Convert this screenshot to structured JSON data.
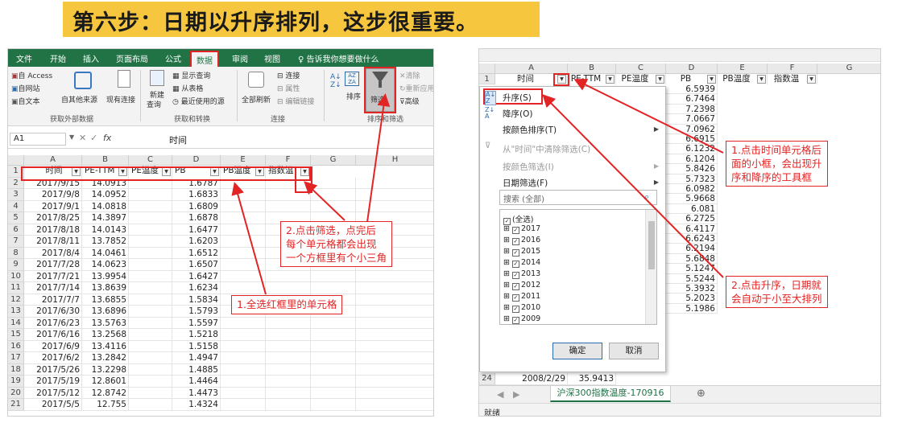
{
  "title": "第六步：日期以升序排列，这步很重要。",
  "left": {
    "menu": [
      "文件",
      "开始",
      "插入",
      "页面布局",
      "公式",
      "数据",
      "审阅",
      "视图"
    ],
    "tell_me": "告诉我你想要做什么",
    "ribbon": {
      "access": "自 Access",
      "web": "自网站",
      "text": "自文本",
      "other_sources": "自其他来源",
      "existing": "现有连接",
      "new_query": "新建",
      "new_query2": "查询",
      "show_query": "显示查询",
      "from_table": "从表格",
      "recent_sources": "最近使用的源",
      "refresh_all": "全部刷新",
      "connections": "连接",
      "properties": "属性",
      "edit_links": "编辑链接",
      "sort": "排序",
      "filter": "筛选",
      "clear": "清除",
      "reapply": "重新应用",
      "advanced": "高级",
      "group_external": "获取外部数据",
      "group_transform": "获取和转换",
      "group_connections": "连接",
      "group_sort_filter": "排序和筛选"
    },
    "namebox": "A1",
    "fx": "fx",
    "formula_value": "时间",
    "columns": [
      "A",
      "B",
      "C",
      "D",
      "E",
      "F",
      "G",
      "H"
    ],
    "headers": [
      "时间",
      "PE-TTM",
      "PE温度",
      "PB",
      "PB温度",
      "指数温"
    ],
    "rows": [
      [
        "2017/9/15",
        "14.0913",
        "1.6787"
      ],
      [
        "2017/9/8",
        "14.0952",
        "1.6833"
      ],
      [
        "2017/9/1",
        "14.0818",
        "1.6809"
      ],
      [
        "2017/8/25",
        "14.3897",
        "1.6878"
      ],
      [
        "2017/8/18",
        "14.0143",
        "1.6477"
      ],
      [
        "2017/8/11",
        "13.7852",
        "1.6203"
      ],
      [
        "2017/8/4",
        "14.0461",
        "1.6512"
      ],
      [
        "2017/7/28",
        "14.0623",
        "1.6507"
      ],
      [
        "2017/7/21",
        "13.9954",
        "1.6427"
      ],
      [
        "2017/7/14",
        "13.8639",
        "1.6234"
      ],
      [
        "2017/7/7",
        "13.6855",
        "1.5834"
      ],
      [
        "2017/6/30",
        "13.6896",
        "1.5793"
      ],
      [
        "2017/6/23",
        "13.5763",
        "1.5597"
      ],
      [
        "2017/6/16",
        "13.2568",
        "1.5218"
      ],
      [
        "2017/6/9",
        "13.4116",
        "1.5158"
      ],
      [
        "2017/6/2",
        "13.2842",
        "1.4947"
      ],
      [
        "2017/5/26",
        "13.2298",
        "1.4885"
      ],
      [
        "2017/5/19",
        "12.8601",
        "1.4464"
      ],
      [
        "2017/5/12",
        "12.8742",
        "1.4473"
      ],
      [
        "2017/5/5",
        "12.755",
        "1.4324"
      ]
    ],
    "note_select": "1.全选红框里的单元格",
    "note_filter": [
      "2.点击筛选，点完后",
      "每个单元格都会出现",
      "一个方框里有个小三角"
    ]
  },
  "right": {
    "columns": [
      "A",
      "B",
      "C",
      "D",
      "E",
      "F",
      "G"
    ],
    "headers": [
      "时间",
      "PE-TTM",
      "PE温度",
      "PB",
      "PB温度",
      "指数温"
    ],
    "pb_values": [
      "6.5939",
      "6.7464",
      "7.2398",
      "7.0667",
      "7.0962",
      "6.6915",
      "6.1232",
      "6.1204",
      "5.8426",
      "5.7323",
      "6.0982",
      "5.9668",
      "6.081",
      "6.2725",
      "6.4117",
      "6.6243",
      "6.2194",
      "5.6848",
      "5.1247",
      "5.5244",
      "5.3932",
      "5.2023",
      "5.1986"
    ],
    "menu": {
      "asc": "升序(S)",
      "desc": "降序(O)",
      "by_color": "按颜色排序(T)",
      "clear_filter": "从\"时间\"中清除筛选(C)",
      "filter_color": "按颜色筛选(I)",
      "date_filter": "日期筛选(F)",
      "search_placeholder": "搜索 (全部)",
      "tree": [
        "(全选)",
        "2017",
        "2016",
        "2015",
        "2014",
        "2013",
        "2012",
        "2011",
        "2010",
        "2009"
      ],
      "ok": "确定",
      "cancel": "取消"
    },
    "last_row": {
      "num": "24",
      "date": "2008/2/29",
      "pe": "35.9413"
    },
    "sheet_tab": "沪深300指数温度-170916",
    "status": "就绪",
    "note_click": [
      "1.点击时间单元格后",
      "面的小框，会出现升",
      "序和降序的工具框"
    ],
    "note_asc": [
      "2.点击升序，日期就",
      "会自动于小至大排列"
    ]
  }
}
